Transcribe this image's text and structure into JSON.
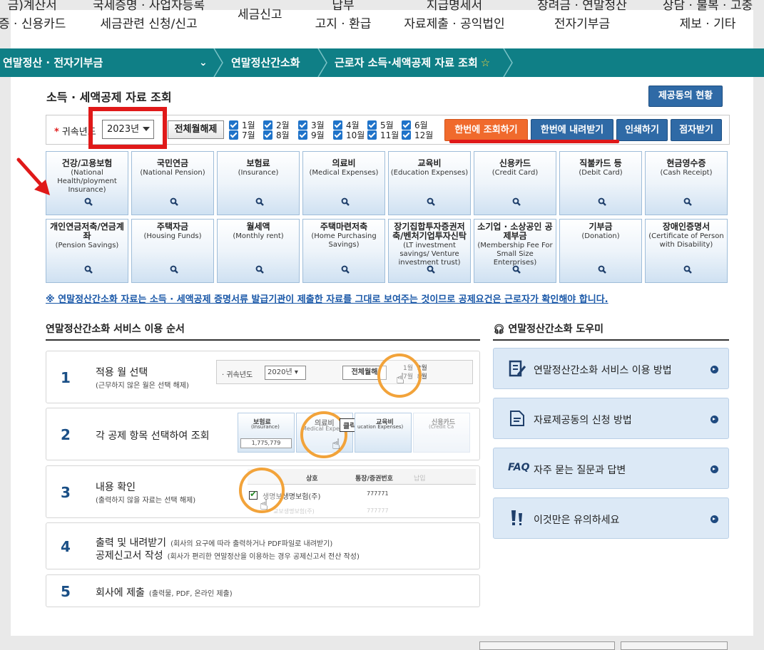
{
  "top_menu": [
    {
      "line1": "금)계산서",
      "line2": "증 · 신용카드"
    },
    {
      "line1": "국세증명 · 사업자등록",
      "line2": "세금관련 신청/신고"
    },
    {
      "line1": "세금신고",
      "line2": ""
    },
    {
      "line1": "납부",
      "line2": "고지 · 환급"
    },
    {
      "line1": "지급명세서",
      "line2": "자료제출 · 공익법인"
    },
    {
      "line1": "장려금 · 연말정산",
      "line2": "전자기부금"
    },
    {
      "line1": "상담 · 불복 · 고충",
      "line2": "제보 · 기타"
    }
  ],
  "breadcrumb": {
    "level1": "연말정산 · 전자기부금",
    "level2": "연말정산간소화",
    "level3": "근로자 소득·세액공제 자료 조회"
  },
  "page": {
    "title": "소득 · 세액공제 자료 조회",
    "status_button": "제공동의 현황"
  },
  "filter": {
    "required_mark": "*",
    "year_label": "귀속년도",
    "year_value": "2023년",
    "clear_all": "전체월해제",
    "months": [
      "1월",
      "2월",
      "3월",
      "4월",
      "5월",
      "6월",
      "7월",
      "8월",
      "9월",
      "10월",
      "11월",
      "12월"
    ],
    "btn_query_all": "한번에 조회하기",
    "btn_download_all": "한번에 내려받기",
    "btn_print": "인쇄하기",
    "btn_braille": "점자받기"
  },
  "categories": [
    {
      "ko": "건강/고용보험",
      "en": "(National Health/ployment Insurance)"
    },
    {
      "ko": "국민연금",
      "en": "(National Pension)"
    },
    {
      "ko": "보험료",
      "en": "(Insurance)"
    },
    {
      "ko": "의료비",
      "en": "(Medical Expenses)"
    },
    {
      "ko": "교육비",
      "en": "(Education Expenses)"
    },
    {
      "ko": "신용카드",
      "en": "(Credit Card)"
    },
    {
      "ko": "직불카드 등",
      "en": "(Debit Card)"
    },
    {
      "ko": "현금영수증",
      "en": "(Cash Receipt)"
    },
    {
      "ko": "개인연금저축/연금계좌",
      "en": "(Pension Savings)"
    },
    {
      "ko": "주택자금",
      "en": "(Housing Funds)"
    },
    {
      "ko": "월세액",
      "en": "(Monthly rent)"
    },
    {
      "ko": "주택마련저축",
      "en": "(Home Purchasing Savings)"
    },
    {
      "ko": "장기집합투자증권저축/벤처기업투자신탁",
      "en": "(LT investment savings/ Venture investment trust)"
    },
    {
      "ko": "소기업 · 소상공인 공제부금",
      "en": "(Membership Fee For Small Size Enterprises)"
    },
    {
      "ko": "기부금",
      "en": "(Donation)"
    },
    {
      "ko": "장애인증명서",
      "en": "(Certificate of Person with Disability)"
    }
  ],
  "notice": "※ 연말정산간소화 자료는 소득 · 세액공제 증명서류 발급기관이 제출한 자료를 그대로 보여주는 것이므로 공제요건은 근로자가 확인해야 합니다.",
  "steps_section": {
    "title": "연말정산간소화 서비스 이용 순서",
    "steps": [
      {
        "num": "1",
        "main": "적용 월 선택",
        "sub": "(근무하지 않은 월은 선택 해제)"
      },
      {
        "num": "2",
        "main": "각 공제 항목 선택하여 조회",
        "sub": ""
      },
      {
        "num": "3",
        "main": "내용 확인",
        "sub": "(출력하지 않을 자료는 선택 해제)"
      },
      {
        "num": "4",
        "main": "출력 및 내려받기",
        "sub": "(회사의 요구에 따라 출력하거나 PDF파일로 내려받기)",
        "main2": "공제신고서 작성",
        "sub2": "(회사가 편리한 연말정산을 이용하는 경우 공제신고서 전산 작성)"
      },
      {
        "num": "5",
        "main": "회사에 제출",
        "sub": "(출력물, PDF, 온라인 제출)"
      }
    ],
    "illus": {
      "s1_label": "귀속년도",
      "s1_year": "2020년",
      "s1_clear": "전체월해",
      "s1_m1": "1월",
      "s1_m2": "2월",
      "s1_m7": "7월",
      "s1_m8": "8월",
      "s2_t1": "보험료",
      "s2_t1en": "(Insurance)",
      "s2_t1val": "1,775,779",
      "s2_t2": "의료비",
      "s2_t2en": "Medical Expen",
      "s2_click": "클릭!",
      "s2_t3": "교육비",
      "s2_t3en": "ucation Expenses)",
      "s2_t4": "신용카드",
      "s2_t4en": "(Credit Ca",
      "s3_h1": "상호",
      "s3_h2": "통장/증권번호",
      "s3_h3": "납입",
      "s3_r1": "생명보생명보험(주)",
      "s3_r1v": "777771",
      "s3_r2": "교보생명보험(주)",
      "s3_r2v": "777777"
    }
  },
  "help_section": {
    "title": "연말정산간소화 도우미",
    "items": [
      {
        "label": "연말정산간소화 서비스 이용 방법",
        "icon": "guide-icon"
      },
      {
        "label": "자료제공동의 신청 방법",
        "icon": "document-icon"
      },
      {
        "label": "자주 묻는 질문과 답변",
        "prefix": "FAQ",
        "icon": "faq-icon"
      },
      {
        "label": "이것만은 유의하세요",
        "icon": "exclamation-icon"
      }
    ]
  },
  "colors": {
    "teal_bar": "#0f7f86",
    "orange_button": "#f06a2c",
    "blue_button": "#2f6aa6",
    "highlight_red": "#e01919",
    "ring_orange": "#f2a33a"
  }
}
